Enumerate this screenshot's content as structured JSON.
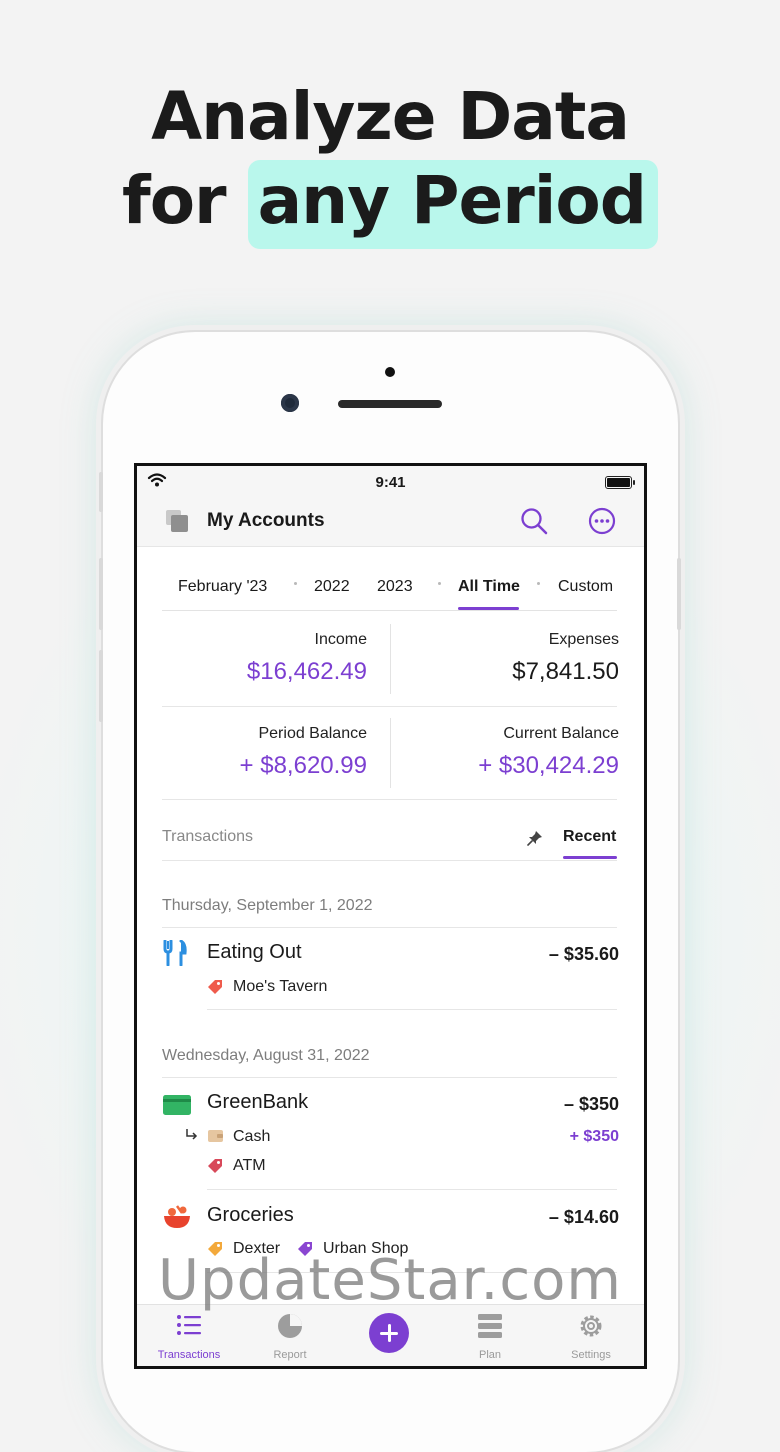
{
  "headline": {
    "line1": "Analyze Data",
    "line2_plain": "for",
    "line2_highlight": "any Period"
  },
  "status_bar": {
    "time": "9:41"
  },
  "nav": {
    "title": "My Accounts"
  },
  "periods": [
    {
      "label": "February '23"
    },
    {
      "label": "2022"
    },
    {
      "label": "2023"
    },
    {
      "label": "All Time",
      "active": true
    },
    {
      "label": "Custom"
    }
  ],
  "stats": {
    "income_label": "Income",
    "income_value": "$16,462.49",
    "expenses_label": "Expenses",
    "expenses_value": "$7,841.50",
    "period_balance_label": "Period Balance",
    "period_balance_value": "+ $8,620.99",
    "current_balance_label": "Current Balance",
    "current_balance_value": "+ $30,424.29"
  },
  "transactions_header": {
    "label": "Transactions",
    "recent": "Recent"
  },
  "groups": [
    {
      "date": "Thursday, September 1, 2022",
      "items": [
        {
          "title": "Eating Out",
          "amount": "– $35.60",
          "tags": [
            "Moe's Tavern"
          ]
        }
      ]
    },
    {
      "date": "Wednesday, August 31, 2022",
      "items": [
        {
          "title": "GreenBank",
          "amount": "– $350",
          "transfer_to": "Cash",
          "transfer_amount": "+ $350",
          "tags": [
            "ATM"
          ]
        },
        {
          "title": "Groceries",
          "amount": "– $14.60",
          "tags": [
            "Dexter",
            "Urban Shop"
          ]
        }
      ]
    }
  ],
  "tabs": [
    {
      "label": "Transactions",
      "icon": "list-icon",
      "active": true
    },
    {
      "label": "Report",
      "icon": "pie-chart-icon"
    },
    {
      "label": "",
      "icon": "plus-icon"
    },
    {
      "label": "Plan",
      "icon": "stack-icon"
    },
    {
      "label": "Settings",
      "icon": "gear-icon"
    }
  ],
  "watermark": "UpdateStar.com",
  "colors": {
    "accent": "#7c3fd1",
    "highlight": "#b9f7ec",
    "tag_red": "#ef5b4c",
    "tag_orange": "#f3a93b",
    "tag_purple": "#8a46d1"
  }
}
